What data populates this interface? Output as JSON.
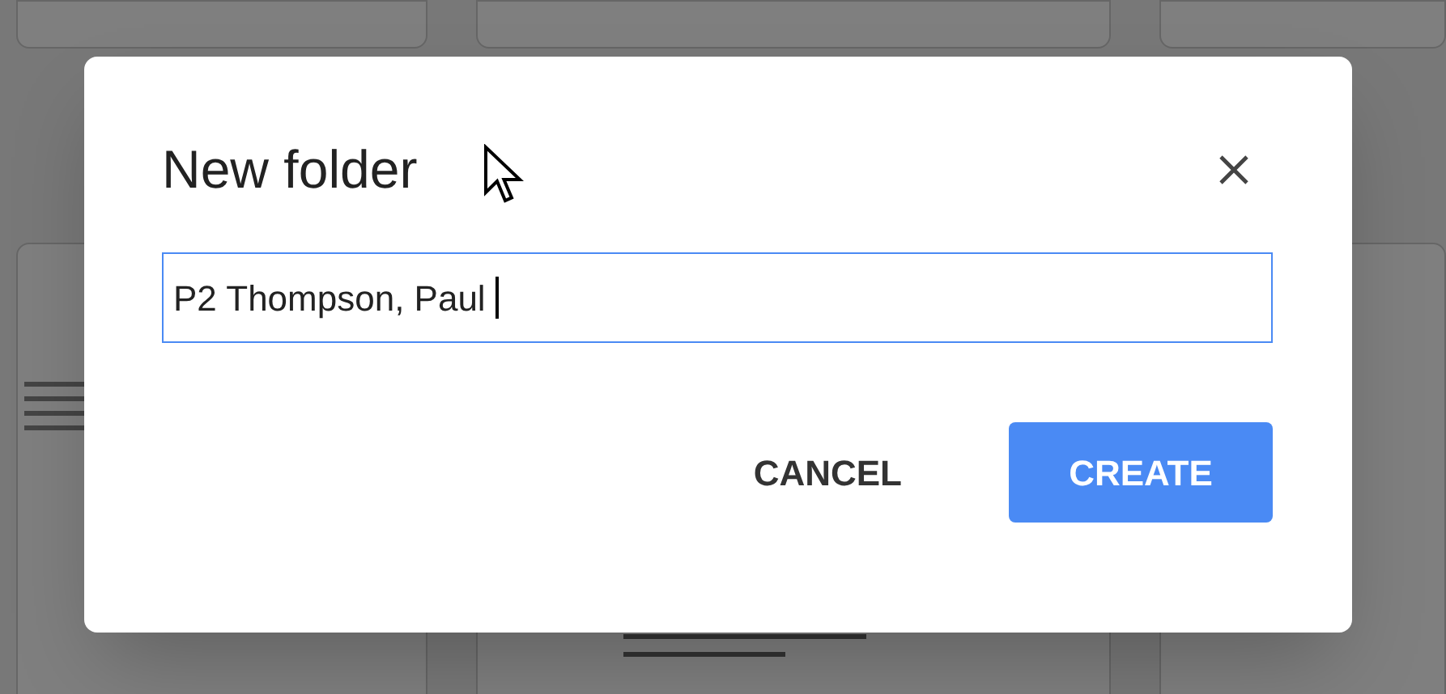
{
  "dialog": {
    "title": "New folder",
    "field": {
      "value": "P2 Thompson, Paul",
      "focused": true
    },
    "buttons": [
      {
        "label": "CANCEL",
        "kind": "text"
      },
      {
        "label": "CREATE",
        "kind": "primary"
      }
    ]
  }
}
